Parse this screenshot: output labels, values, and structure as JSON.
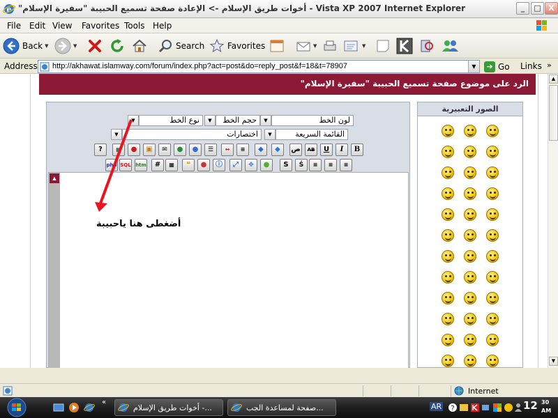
{
  "window": {
    "title": "\"أخوات طريق الإسلام -> الإعادة صفحة تسميع الحبيبة \"سفيرة الإسلام - Vista XP 2007 Internet Explorer",
    "minimize": "_",
    "maximize": "□",
    "close": "X"
  },
  "menu": [
    "File",
    "Edit",
    "View",
    "Favorites",
    "Tools",
    "Help"
  ],
  "toolbar": {
    "back": "Back",
    "search": "Search",
    "favorites": "Favorites"
  },
  "address": {
    "label": "Address",
    "url": "http://akhawat.islamway.com/forum/index.php?act=post&do=reply_post&f=18&t=78907",
    "go": "Go",
    "links": "Links",
    "more": "»"
  },
  "page": {
    "heading": "الرد على موضوع صفحة تسميع الحبيبة \"سفيرة الإسلام\"",
    "smilies_title": "الصور التعبيرية",
    "font_type": "نوع الخط",
    "font_size": "حجم الخط",
    "font_color": "لون الخط",
    "shortcuts": "اختصارات",
    "quick_list": "القائمة السريعة",
    "annotation": "أضغطى هنا ياحبيبة",
    "format_buttons_row1": [
      "B",
      "I",
      "U",
      "AB",
      "ص",
      "",
      "",
      "",
      "",
      "",
      "",
      "",
      "",
      "",
      "",
      "",
      "?"
    ],
    "format_buttons_row2": [
      "",
      "",
      "",
      "S",
      "",
      "",
      "",
      "",
      "",
      "",
      "",
      "#",
      "htm",
      "SQL",
      "php"
    ]
  },
  "status": {
    "zone": "Internet"
  },
  "taskbar": {
    "task1": "أخوات طريق الإسلام -...",
    "task2": "صفحة لمساعدة الجب...",
    "lang": "AR",
    "time": "12",
    "time_min": "30",
    "time_ampm": "AM",
    "expand": "«"
  },
  "colors": {
    "accent": "#8c1a37",
    "panel": "#d9dde6",
    "arrow": "#e8141e"
  }
}
